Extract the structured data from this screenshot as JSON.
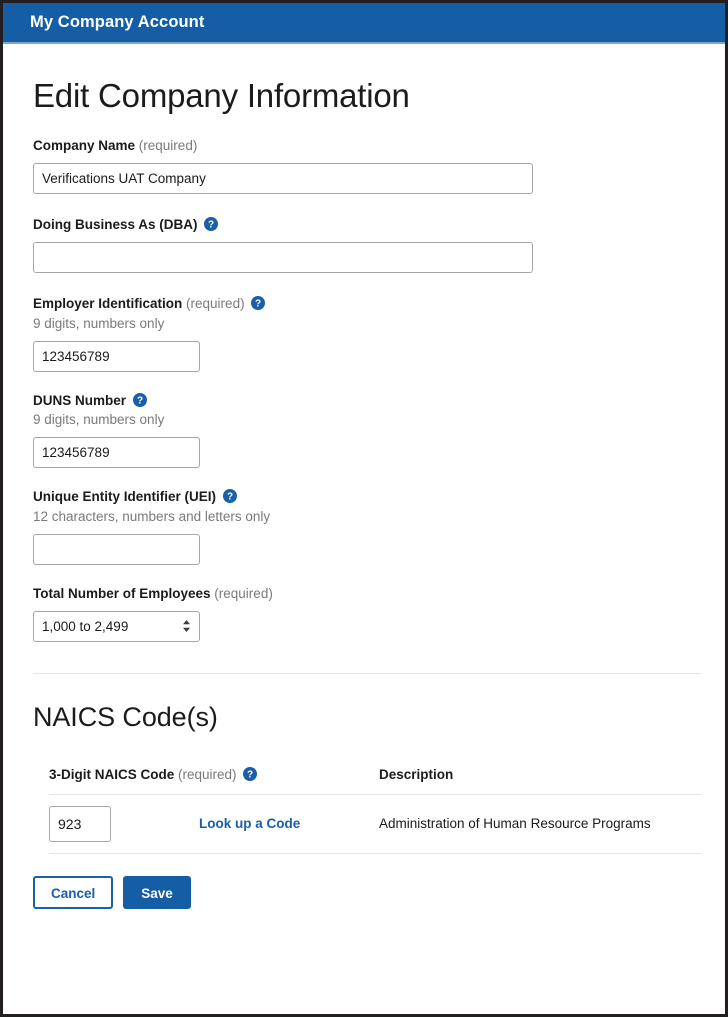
{
  "app": {
    "title": "My Company Account",
    "header_bg": "#155da4",
    "header_rule": "#7ca7d0"
  },
  "page": {
    "title": "Edit Company Information"
  },
  "icons": {
    "help": "help-circle-icon",
    "select_arrows": "chevron-up-down-icon"
  },
  "form": {
    "company_name": {
      "label": "Company Name",
      "required_text": "(required)",
      "value": "Verifications UAT Company",
      "placeholder": ""
    },
    "dba": {
      "label": "Doing Business As (DBA)",
      "value": "",
      "placeholder": ""
    },
    "ein": {
      "label": "Employer Identification",
      "required_text": "(required)",
      "hint": "9 digits, numbers only",
      "value": "123456789",
      "placeholder": ""
    },
    "duns": {
      "label": "DUNS Number",
      "hint": "9 digits, numbers only",
      "value": "123456789",
      "placeholder": ""
    },
    "uei": {
      "label": "Unique Entity Identifier (UEI)",
      "hint": "12 characters, numbers and letters only",
      "value": "",
      "placeholder": ""
    },
    "employees": {
      "label": "Total Number of Employees",
      "required_text": "(required)",
      "selected": "1,000 to 2,499",
      "options": [
        "1,000 to 2,499"
      ]
    }
  },
  "naics": {
    "section_title": "NAICS Code(s)",
    "columns": {
      "code": "3-Digit NAICS Code",
      "code_required_text": "(required)",
      "description": "Description"
    },
    "rows": [
      {
        "code": "923",
        "lookup_label": "Look up a Code",
        "description": "Administration of Human Resource Programs"
      }
    ]
  },
  "actions": {
    "cancel_label": "Cancel",
    "save_label": "Save",
    "primary_color": "#155da4",
    "link_color": "#1a5fa8"
  }
}
